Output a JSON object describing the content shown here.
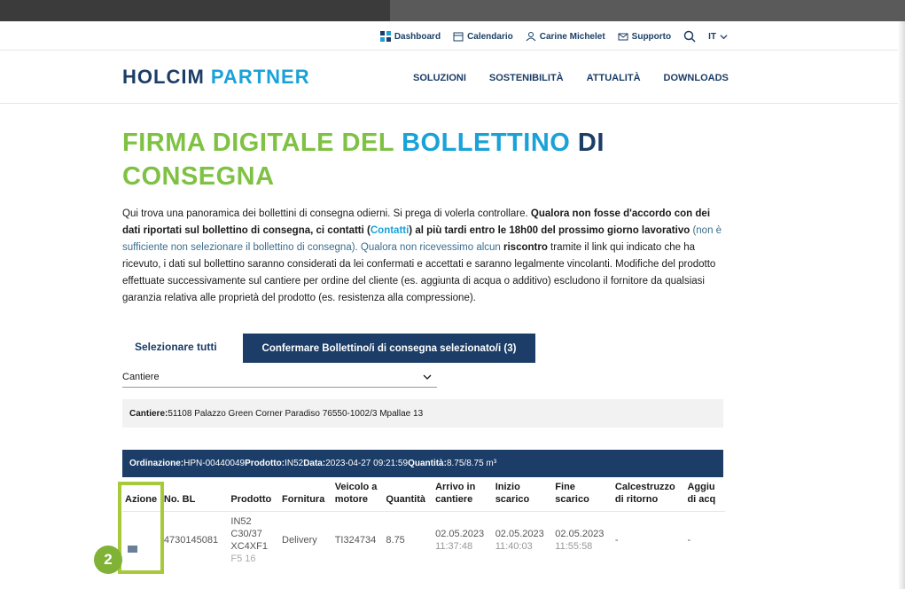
{
  "util": {
    "dashboard": "Dashboard",
    "calendario": "Calendario",
    "user": "Carine Michelet",
    "supporto": "Supporto",
    "lang": "IT"
  },
  "logo": {
    "part1": "HOLCIM",
    "part2": "PARTNER"
  },
  "nav": [
    "SOLUZIONI",
    "SOSTENIBILITÀ",
    "ATTUALITÀ",
    "DOWNLOADS"
  ],
  "title": {
    "l1": "FIRMA DIGITALE DEL ",
    "l2": "BOLLETTINO",
    "l3": " DI",
    "l4": "CONSEGNA"
  },
  "intro": {
    "t1": "Qui trova una panoramica dei bollettini di consegna odierni. Si prega di volerla controllare. ",
    "b1": "Qualora non fosse d'accordo con dei dati riportati sul bollettino di consegna, ci contatti (",
    "link": "Contatti",
    "b2": ") al più tardi entro le 18h00 del prossimo giorno lavorativo",
    "t2": " (non è sufficiente non selezionare il bollettino di consegna). Qualora non ricevessimo alcun ",
    "b3": "riscontro",
    "t3": " tramite il link qui indicato che ha ricevuto, i dati sul bollettino saranno considerati da lei confermati e accettati e saranno legalmente vincolanti. Modifiche del prodotto effettuate successivamente sul cantiere per ordine del cliente (es. aggiunta di acqua o additivo) escludono il fornitore da qualsiasi garanzia relativa alle proprietà del prodotto (es. resistenza alla compressione)."
  },
  "buttons": {
    "select_all": "Selezionare tutti",
    "confirm": "Confermare Bollettino/i di consegna selezionato/i (3)"
  },
  "select": {
    "value": "Cantiere"
  },
  "cantiere": {
    "label": "Cantiere:",
    "value": " 51108 Palazzo Green Corner Paradiso 76550-1002/3 Mpallae 13"
  },
  "order": {
    "ord_label": "Ordinazione:",
    "ord_value": " HPN-00440049 ",
    "prod_label": "Prodotto:",
    "prod_value": " IN52 ",
    "date_label": "Data:",
    "date_value": " 2023-04-27 09:21:59 ",
    "qty_label": "Quantità:",
    "qty_value": " 8.75/8.75 m³"
  },
  "table": {
    "headers": [
      "Azione",
      "No. BL",
      "Prodotto",
      "Fornitura",
      "Veicolo a motore",
      "Quantità",
      "Arrivo in cantiere",
      "Inizio scarico",
      "Fine scarico",
      "Calcestruzzo di ritorno",
      "Aggiu di acq"
    ],
    "row": {
      "bl": "4730145081",
      "prodotto_l1": "IN52",
      "prodotto_l2": "C30/37",
      "prodotto_l3": "XC4XF1",
      "prodotto_l4": "F5 16",
      "fornitura": "Delivery",
      "veicolo": "TI324734",
      "quantita": "8.75",
      "arrivo_date": "02.05.2023",
      "arrivo_time": "11:37:48",
      "inizio_date": "02.05.2023",
      "inizio_time": "11:40:03",
      "fine_date": "02.05.2023",
      "fine_time": "11:55:58",
      "ritorno": "-",
      "aggiunta": "-"
    }
  },
  "badge": "2",
  "colors": {
    "navy": "#1b3d67",
    "blue": "#1aa2d8",
    "green": "#7fc243",
    "highlight": "#a8c93a"
  }
}
